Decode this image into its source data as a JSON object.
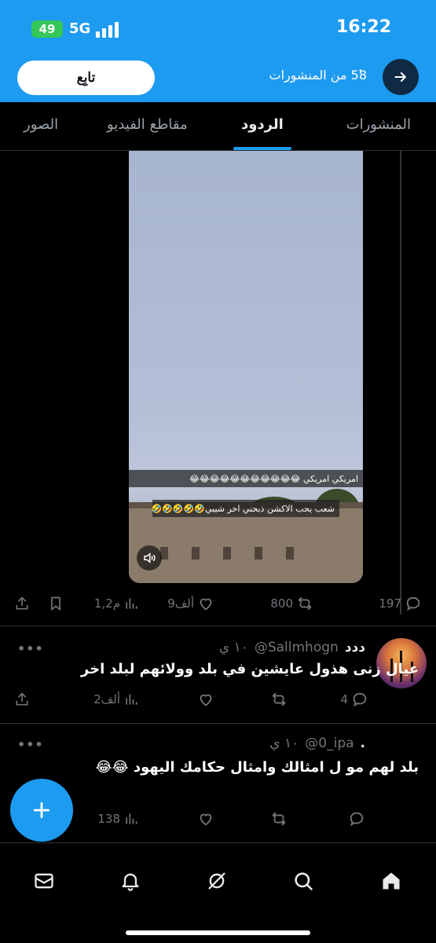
{
  "status_bar": {
    "battery": "49",
    "network": "5G",
    "time": "16:22"
  },
  "header": {
    "follow_label": "تابِع",
    "posts_count": "58 من المنشورات",
    "back_icon": "arrow-right-icon"
  },
  "tabs": [
    {
      "label": "المنشورات",
      "active": false
    },
    {
      "label": "الردود",
      "active": true
    },
    {
      "label": "مقاطع الفيديو",
      "active": false
    },
    {
      "label": "الصور",
      "active": false
    }
  ],
  "video": {
    "caption_1": "امريكي امريكي 😂😂😂😂😂😂😂😂😂😂😂",
    "caption_2": "شعب يحب الاكشن ذبحني اخر شيبي🤣🤣🤣🤣🤣"
  },
  "main_post_actions": {
    "replies": "197",
    "reposts": "800",
    "likes": "9ألف",
    "views": "1,2م"
  },
  "replies": [
    {
      "name": "ددد",
      "handle": "@Sallmhogn",
      "time": "١٠ ي",
      "text": "عيال زنى هذول عايشين في بلد وولائهم لبلد اخر",
      "replies": "4",
      "reposts": "",
      "likes": "",
      "views": "2ألف"
    },
    {
      "name": ".",
      "handle": "@0_ipa",
      "time": "١٠ ي",
      "text": "بلد لهم مو ل امثالك وامثال حكامك اليهود 😂😂",
      "replies": "",
      "reposts": "",
      "likes": "",
      "views": "138"
    }
  ],
  "more_label": "•••",
  "colors": {
    "accent": "#1d9bf0",
    "background": "#000000",
    "muted": "#71767b"
  }
}
